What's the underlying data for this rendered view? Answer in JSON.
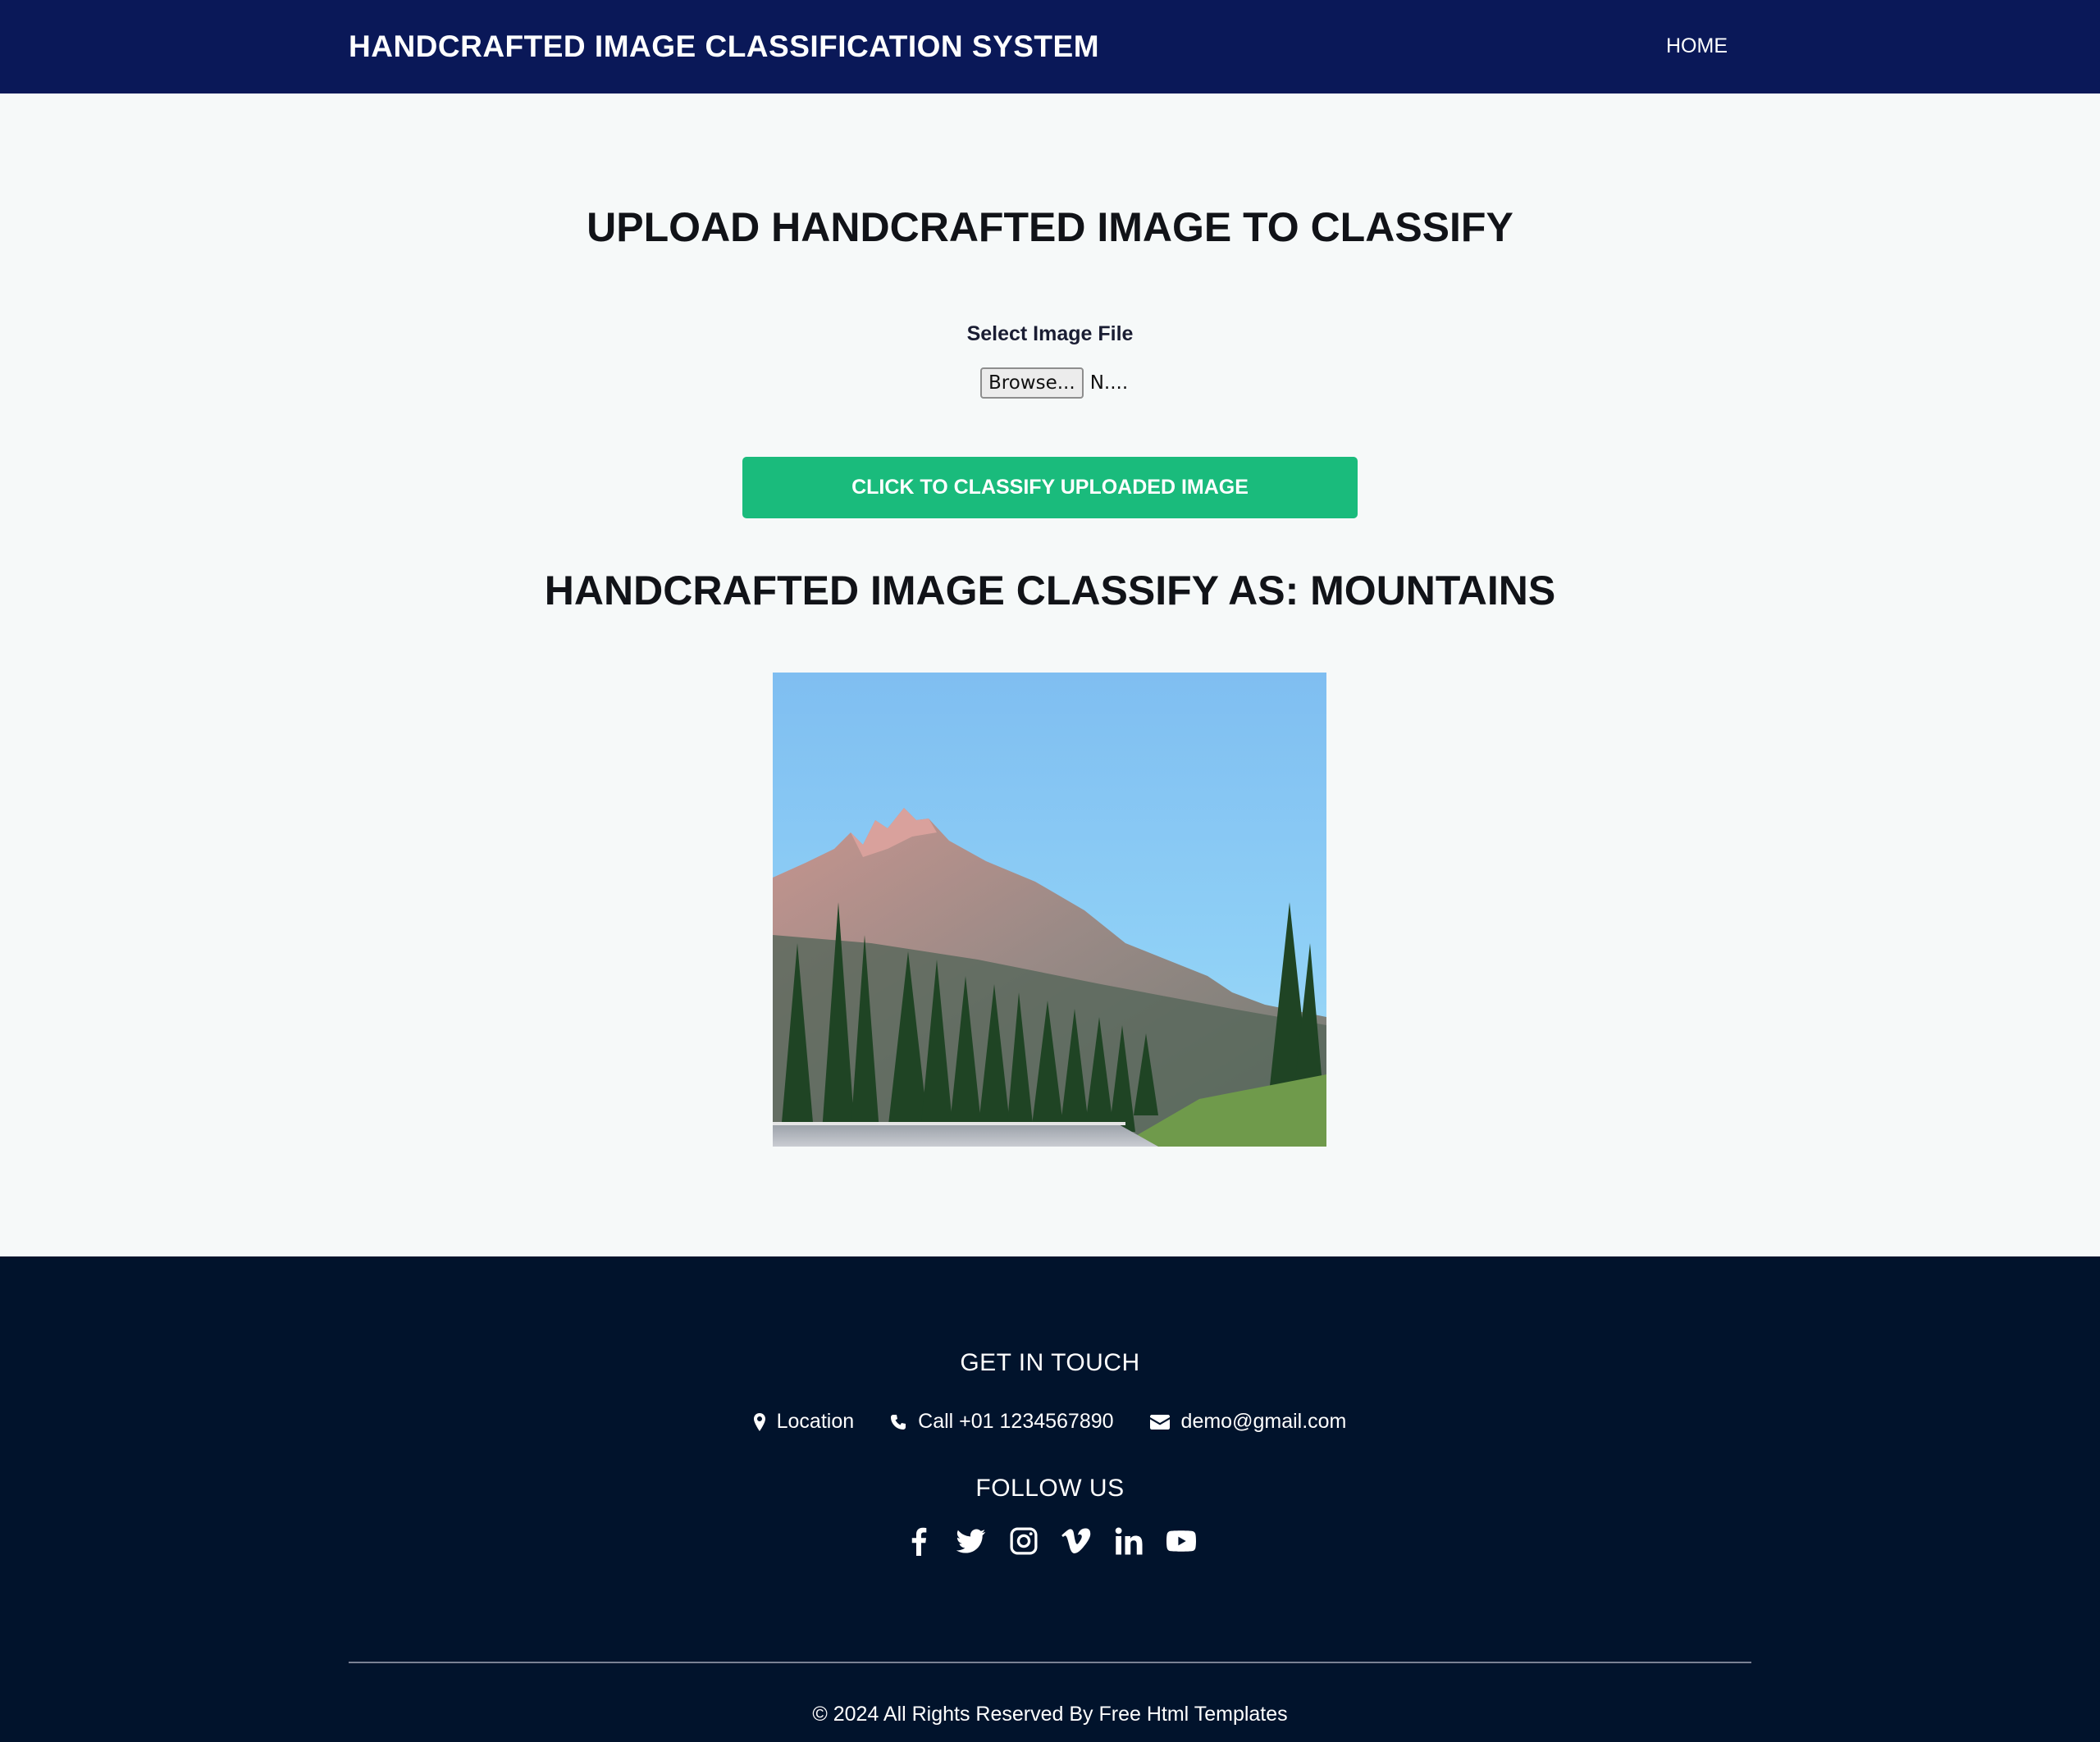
{
  "navbar": {
    "brand": "HANDCRAFTED IMAGE CLASSIFICATION SYSTEM",
    "home_link": "HOME"
  },
  "upload": {
    "title": "UPLOAD HANDCRAFTED IMAGE TO CLASSIFY",
    "file_label": "Select Image File",
    "browse_label": "Browse...",
    "file_name": "N....",
    "classify_button": "CLICK TO CLASSIFY UPLOADED IMAGE"
  },
  "result": {
    "title": "HANDCRAFTED IMAGE CLASSIFY AS: MOUNTAINS",
    "image_icon": "uploaded-mountain-photo"
  },
  "footer": {
    "contact_heading": "GET IN TOUCH",
    "contacts": [
      {
        "icon": "map-marker-icon",
        "label": "Location"
      },
      {
        "icon": "phone-icon",
        "label": "Call +01 1234567890"
      },
      {
        "icon": "envelope-icon",
        "label": "demo@gmail.com"
      }
    ],
    "follow_heading": "FOLLOW US",
    "socials": [
      "facebook-icon",
      "twitter-icon",
      "instagram-icon",
      "vimeo-icon",
      "linkedin-icon",
      "youtube-icon"
    ],
    "copyright": "© 2024 All Rights Reserved By Free Html Templates"
  },
  "colors": {
    "navbar_bg": "#0a1858",
    "page_bg": "#f6f9f9",
    "button_green": "#1abb7c",
    "footer_bg": "#01132c"
  }
}
